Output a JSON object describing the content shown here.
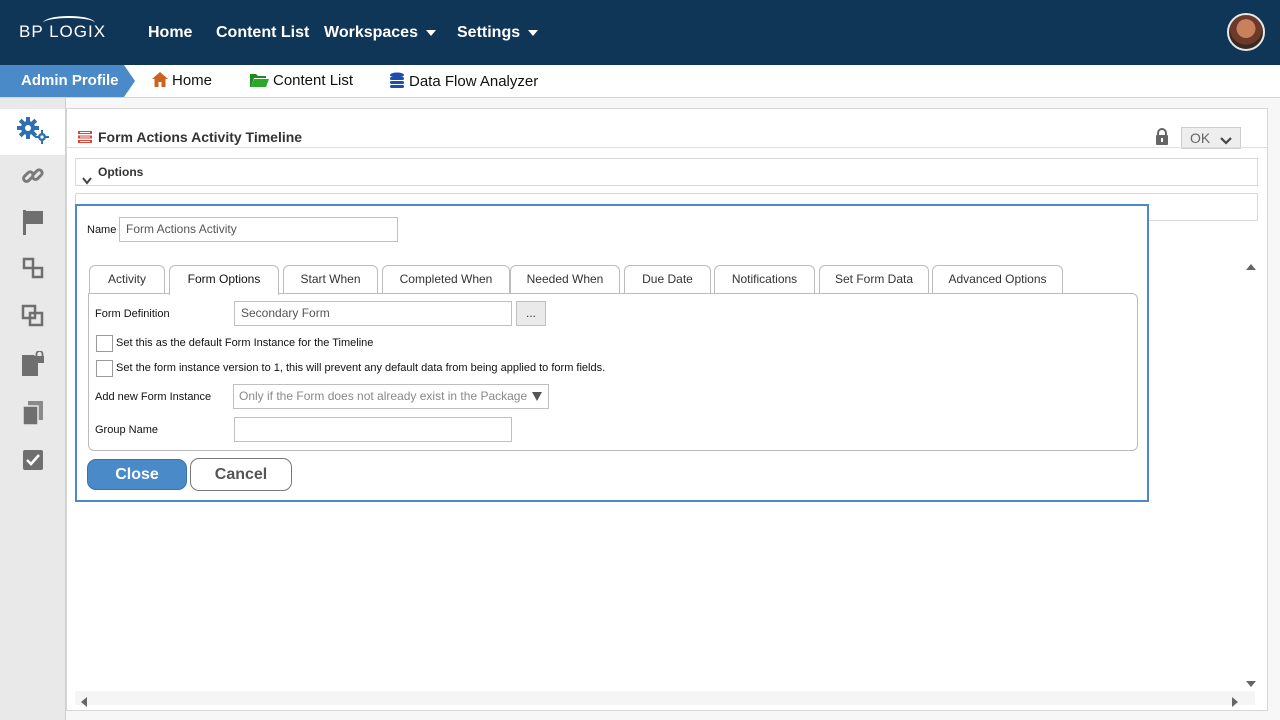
{
  "brand": {
    "logo_text": "BP LOGIX"
  },
  "topnav": {
    "items": [
      {
        "label": "Home"
      },
      {
        "label": "Content List"
      },
      {
        "label": "Workspaces"
      },
      {
        "label": "Settings"
      }
    ]
  },
  "breadcrumb": {
    "profile": "Admin Profile",
    "items": [
      {
        "label": "Home",
        "icon": "home-icon"
      },
      {
        "label": "Content List",
        "icon": "folder-icon"
      },
      {
        "label": "Data Flow Analyzer",
        "icon": "database-icon"
      }
    ]
  },
  "sidebar": {
    "items": [
      {
        "icon": "gears-icon"
      },
      {
        "icon": "link-icon"
      },
      {
        "icon": "flag-icon"
      },
      {
        "icon": "workflow-icon"
      },
      {
        "icon": "copy-layers-icon"
      },
      {
        "icon": "locked-document-icon"
      },
      {
        "icon": "documents-icon"
      },
      {
        "icon": "checklist-icon"
      }
    ]
  },
  "panel": {
    "title": "Form Actions Activity Timeline",
    "ok_label": "OK",
    "sections": [
      {
        "label": "Options"
      }
    ]
  },
  "dialog": {
    "name_label": "Name",
    "name_value": "Form Actions Activity",
    "tabs": [
      {
        "label": "Activity"
      },
      {
        "label": "Form Options"
      },
      {
        "label": "Start When"
      },
      {
        "label": "Completed When"
      },
      {
        "label": "Needed When"
      },
      {
        "label": "Due Date"
      },
      {
        "label": "Notifications"
      },
      {
        "label": "Set Form Data"
      },
      {
        "label": "Advanced Options"
      }
    ],
    "active_tab": "Form Options",
    "form_definition_label": "Form Definition",
    "form_definition_value": "Secondary Form",
    "browse_label": "...",
    "checkbox1_label": "Set this as the default Form Instance for the Timeline",
    "checkbox2_label": "Set the form instance version to 1, this will prevent any default data from being applied to form fields.",
    "add_instance_label": "Add new Form Instance",
    "add_instance_value": "Only if the Form does not already exist in the Package",
    "group_name_label": "Group Name",
    "group_name_value": "",
    "close_label": "Close",
    "cancel_label": "Cancel"
  },
  "colors": {
    "nav_bg": "#0f3557",
    "accent": "#4a8ac9"
  }
}
